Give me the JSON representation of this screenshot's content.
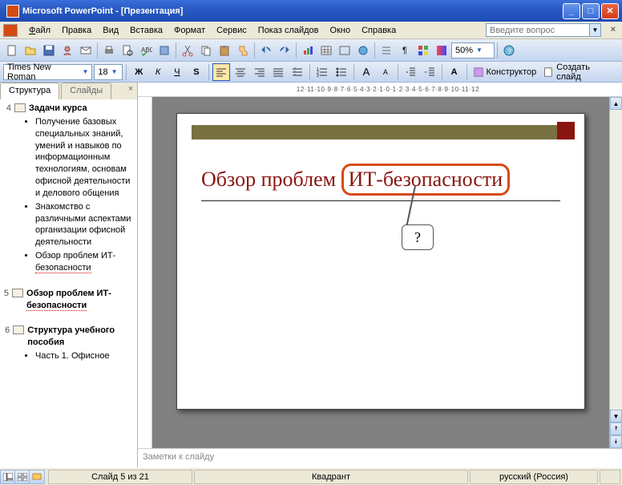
{
  "window": {
    "title": "Microsoft PowerPoint - [Презентация]"
  },
  "menu": {
    "file": "Файл",
    "edit": "Правка",
    "view": "Вид",
    "insert": "Вставка",
    "format": "Формат",
    "service": "Сервис",
    "show": "Показ слайдов",
    "window": "Окно",
    "help": "Справка"
  },
  "ask": {
    "placeholder": "Введите вопрос"
  },
  "toolbar": {
    "font": "Times New Roman",
    "size": "18",
    "zoom": "50%",
    "designer": "Конструктор",
    "newslide": "Создать слайд"
  },
  "tabs": {
    "outline": "Структура",
    "slides": "Слайды"
  },
  "outline": {
    "s4": {
      "num": "4",
      "title": "Задачи курса",
      "b1": "Получение базовых специальных знаний, умений и навыков по информационным технологиям, основам офисной деятельности и делового общения",
      "b2": "Знакомство с различными аспектами организации офисной деятельности",
      "b3": "Обзор проблем ИТ-безопасности"
    },
    "s5": {
      "num": "5",
      "title": "Обзор проблем ИТ-безопасности"
    },
    "s6": {
      "num": "6",
      "title": "Структура учебного пособия",
      "b1": "Часть 1. Офисное"
    }
  },
  "ruler": "12·11·10·9·8·7·6·5·4·3·2·1·0·1·2·3·4·5·6·7·8·9·10·11·12",
  "slide": {
    "title_pre": "Обзор проблем ",
    "title_circ": "ИТ-безопасности",
    "callout": "?"
  },
  "notes": {
    "placeholder": "Заметки к слайду"
  },
  "status": {
    "slide": "Слайд 5 из 21",
    "layout": "Квадрант",
    "lang": "русский (Россия)"
  }
}
